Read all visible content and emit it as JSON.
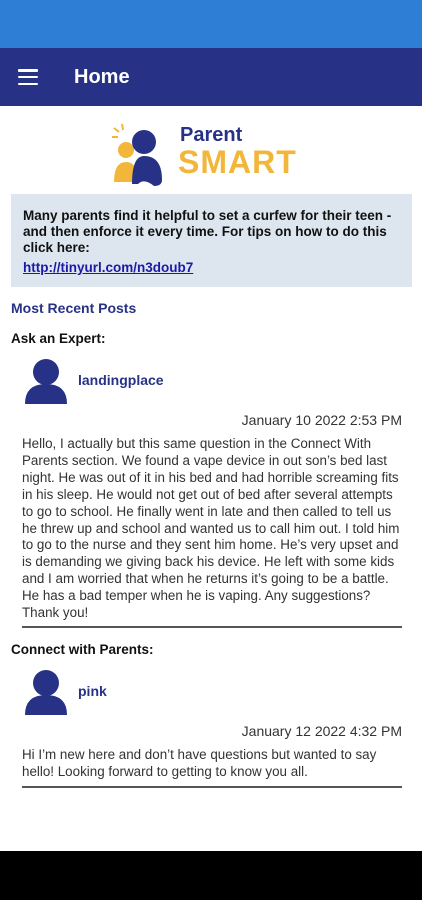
{
  "header": {
    "title": "Home"
  },
  "logo": {
    "line1": "Parent",
    "line2": "SMART"
  },
  "tip": {
    "text": "Many parents find it helpful to set a curfew for their teen - and then enforce it every time. For tips on how to do this click here:",
    "link": "http://tinyurl.com/n3doub7"
  },
  "recent_label": "Most Recent Posts",
  "sections": [
    {
      "heading": "Ask an Expert:",
      "user": "landingplace",
      "timestamp": "January 10 2022 2:53 PM",
      "body": "Hello, I actually but this same question in the Connect With Parents section. We found a vape device in out son’s bed last night. He was out of it in his bed and had horrible screaming fits in his sleep. He would not get out of bed after several attempts to go to school. He finally went in late and then called to tell us he threw up and school and wanted us to call him out. I told him to go to the nurse and they sent him home. He’s very upset and is demanding we giving back his device. He left with some kids and I am worried that when he returns it’s going to be a battle. He has a bad temper when he is vaping. Any suggestions? Thank you!"
    },
    {
      "heading": "Connect with Parents:",
      "user": "pink",
      "timestamp": "January 12 2022 4:32 PM",
      "body": "Hi I’m new here and don’t have questions but wanted to say hello! Looking forward to getting to know you all."
    }
  ],
  "colors": {
    "status_bar": "#2e7ed6",
    "app_bar": "#273287",
    "brand_navy": "#273287",
    "brand_gold": "#f2b73a",
    "tip_bg": "#dde6ef"
  }
}
